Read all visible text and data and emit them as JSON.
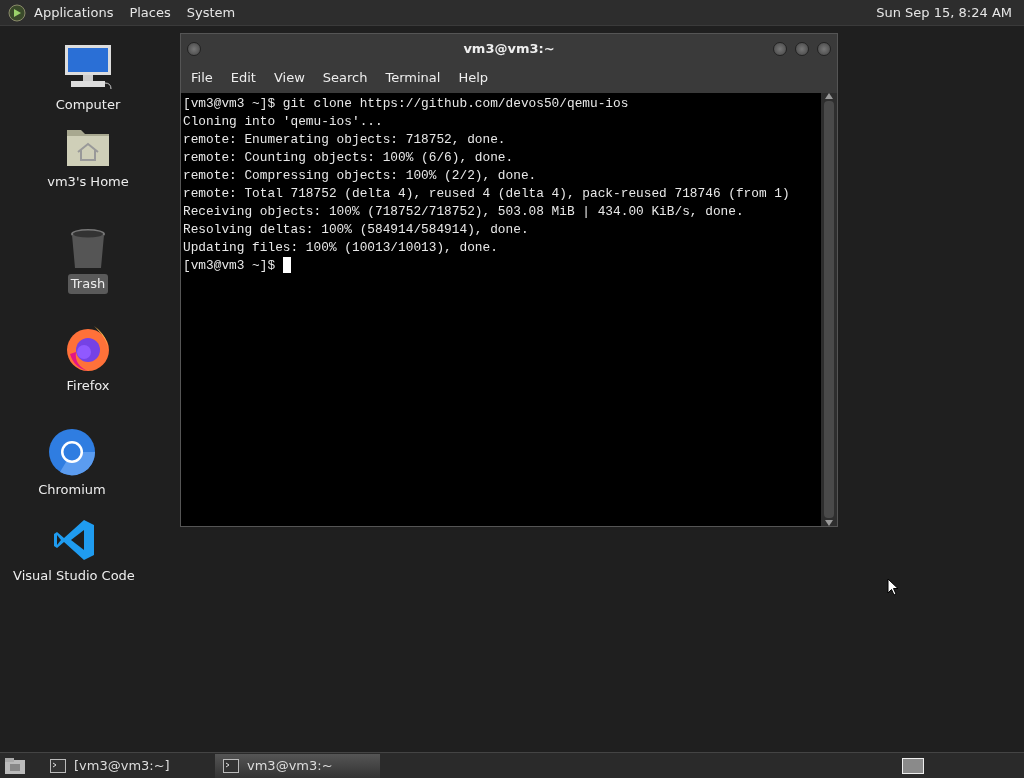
{
  "top_panel": {
    "menus": [
      "Applications",
      "Places",
      "System"
    ],
    "clock": "Sun Sep 15,  8:24 AM"
  },
  "desktop_icons": [
    {
      "label": "Computer",
      "kind": "computer",
      "selected": false
    },
    {
      "label": "vm3's Home",
      "kind": "home",
      "selected": false
    },
    {
      "label": "Trash",
      "kind": "trash",
      "selected": true
    },
    {
      "label": "Firefox",
      "kind": "firefox",
      "selected": false
    },
    {
      "label": "Chromium",
      "kind": "chromium",
      "selected": false
    },
    {
      "label": "Visual Studio Code",
      "kind": "vscode",
      "selected": false
    }
  ],
  "terminal": {
    "title": "vm3@vm3:~",
    "menu": [
      "File",
      "Edit",
      "View",
      "Search",
      "Terminal",
      "Help"
    ],
    "lines": [
      "[vm3@vm3 ~]$ git clone https://github.com/devos50/qemu-ios",
      "Cloning into 'qemu-ios'...",
      "remote: Enumerating objects: 718752, done.",
      "remote: Counting objects: 100% (6/6), done.",
      "remote: Compressing objects: 100% (2/2), done.",
      "remote: Total 718752 (delta 4), reused 4 (delta 4), pack-reused 718746 (from 1)",
      "Receiving objects: 100% (718752/718752), 503.08 MiB | 434.00 KiB/s, done.",
      "Resolving deltas: 100% (584914/584914), done.",
      "Updating files: 100% (10013/10013), done."
    ],
    "prompt": "[vm3@vm3 ~]$"
  },
  "taskbar": {
    "items": [
      {
        "label": "[vm3@vm3:~]",
        "selected": false
      },
      {
        "label": "vm3@vm3:~",
        "selected": true
      }
    ]
  }
}
